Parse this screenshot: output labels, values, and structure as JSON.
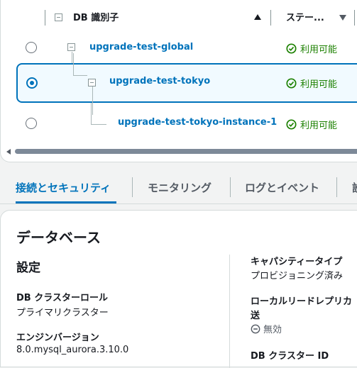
{
  "table": {
    "columns": {
      "identifier": "DB 識別子",
      "status": "ステー..."
    },
    "rows": [
      {
        "name": "upgrade-test-global",
        "status": "利用可能",
        "selected": false
      },
      {
        "name": "upgrade-test-tokyo",
        "status": "利用可能",
        "selected": true
      },
      {
        "name": "upgrade-test-tokyo-instance-1",
        "status": "利用可能",
        "selected": false
      }
    ]
  },
  "tabs": [
    {
      "label": "接続とセキュリティ",
      "active": true
    },
    {
      "label": "モニタリング",
      "active": false
    },
    {
      "label": "ログとイベント",
      "active": false
    },
    {
      "label": "設",
      "active": false
    }
  ],
  "details": {
    "panel_title": "データベース",
    "section_title": "設定",
    "left": [
      {
        "key": "DB クラスターロール",
        "value": "プライマリクラスター"
      },
      {
        "key": "エンジンバージョン",
        "value": "8.0.mysql_aurora.3.10.0"
      }
    ],
    "right": {
      "capacity_key": "キャパシティータイプ",
      "capacity_value": "プロビジョニング済み",
      "local_read_key_line1": "ローカルリードレプリカ",
      "local_read_key_line2": "送",
      "local_read_value": "無効",
      "cluster_id_key": "DB クラスター ID"
    }
  },
  "colors": {
    "link": "#0073bb",
    "available": "#1d8102",
    "selected_bg": "#f1faff"
  }
}
